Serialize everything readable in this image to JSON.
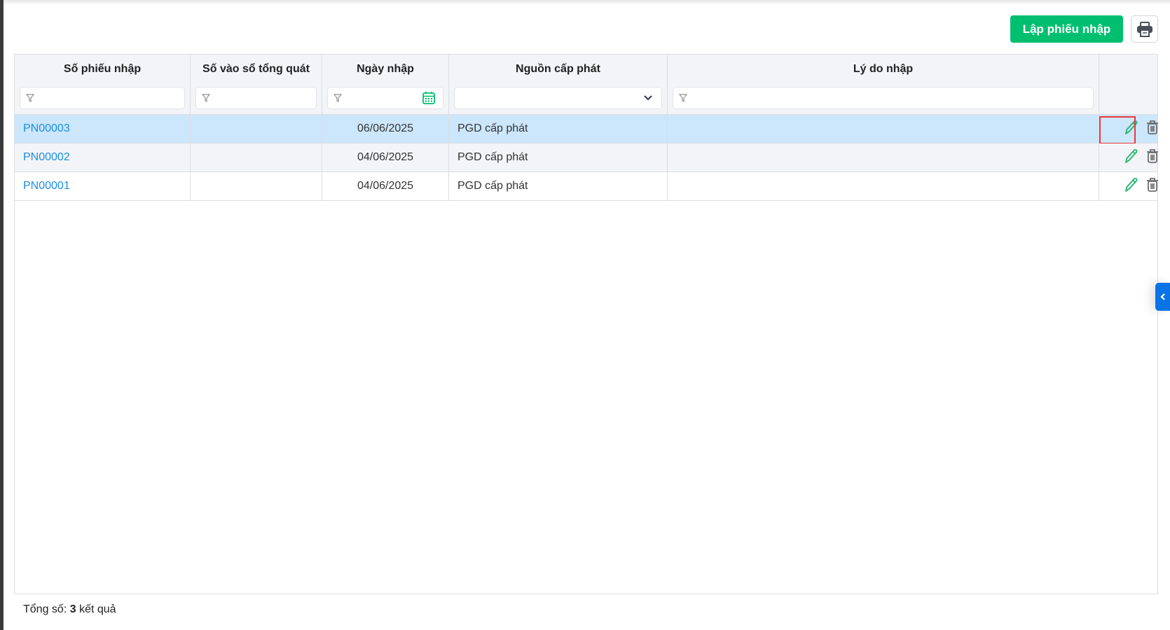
{
  "toolbar": {
    "create_label": "Lập phiếu nhập",
    "print_icon": "printer-icon"
  },
  "table": {
    "columns": [
      "Số phiếu nhập",
      "Số vào sổ tổng quát",
      "Ngày nhập",
      "Nguồn cấp phát",
      "Lý do nhập"
    ],
    "rows": [
      {
        "code": "PN00003",
        "ledger": "",
        "date": "06/06/2025",
        "source": "PGD cấp phát",
        "reason": ""
      },
      {
        "code": "PN00002",
        "ledger": "",
        "date": "04/06/2025",
        "source": "PGD cấp phát",
        "reason": ""
      },
      {
        "code": "PN00001",
        "ledger": "",
        "date": "04/06/2025",
        "source": "PGD cấp phát",
        "reason": ""
      }
    ]
  },
  "footer": {
    "label": "Tổng số:",
    "count": "3",
    "suffix": "kết quả"
  },
  "colors": {
    "primary": "#00bf6f",
    "link": "#1a8fe3",
    "selected_row": "#cce6fb",
    "side_tab": "#0a74e6"
  }
}
